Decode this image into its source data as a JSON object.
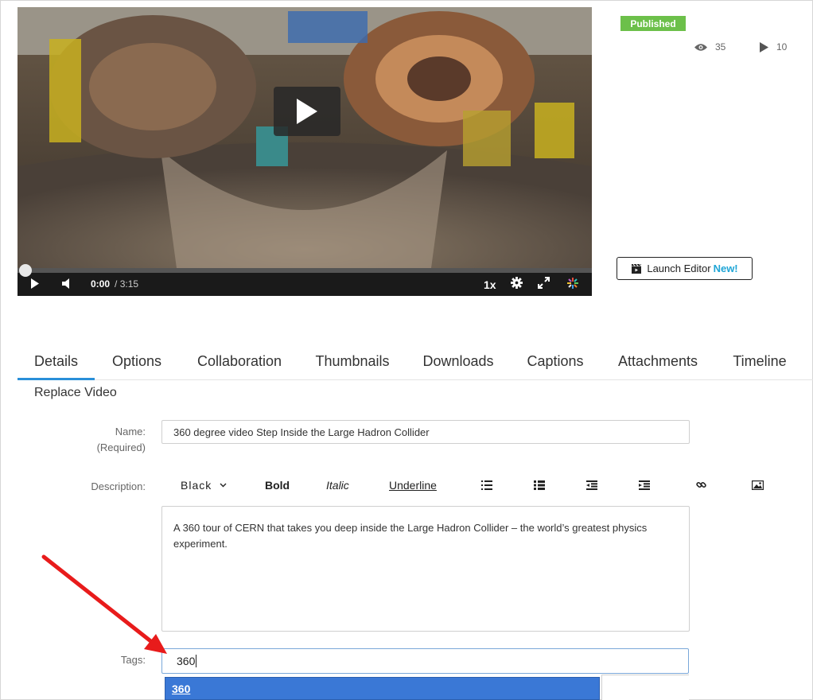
{
  "player": {
    "time_current": "0:00",
    "time_total": "/ 3:15",
    "speed": "1x",
    "progress": 0
  },
  "status": {
    "label": "Published",
    "color": "#6cc04a"
  },
  "stats": {
    "views": "35",
    "plays": "10"
  },
  "launch_editor": {
    "label": "Launch Editor",
    "badge": "New!"
  },
  "tabs": [
    "Details",
    "Options",
    "Collaboration",
    "Thumbnails",
    "Downloads",
    "Captions",
    "Attachments",
    "Timeline"
  ],
  "active_tab": "Details",
  "replace_video": "Replace Video",
  "form": {
    "name_label": "Name:",
    "name_required": "(Required)",
    "name_value": "360 degree video Step Inside the Large Hadron Collider",
    "description_label": "Description:",
    "description_value": "A 360 tour of CERN that takes you deep inside the Large Hadron Collider – the world’s greatest physics experiment.",
    "tags_label": "Tags:",
    "tags_value": "360",
    "tag_suggestion": "360"
  },
  "toolbar": {
    "color": "Black",
    "bold": "Bold",
    "italic": "Italic",
    "underline": "Underline",
    "icons": [
      "bullet-list-icon",
      "numbered-list-icon",
      "outdent-icon",
      "indent-icon",
      "link-icon",
      "image-icon"
    ]
  },
  "colors": {
    "accent": "#2a8fd9",
    "new_badge": "#1fa5d6",
    "suggest_bg": "#3a78d6",
    "annotation_arrow": "#e81b1b"
  }
}
